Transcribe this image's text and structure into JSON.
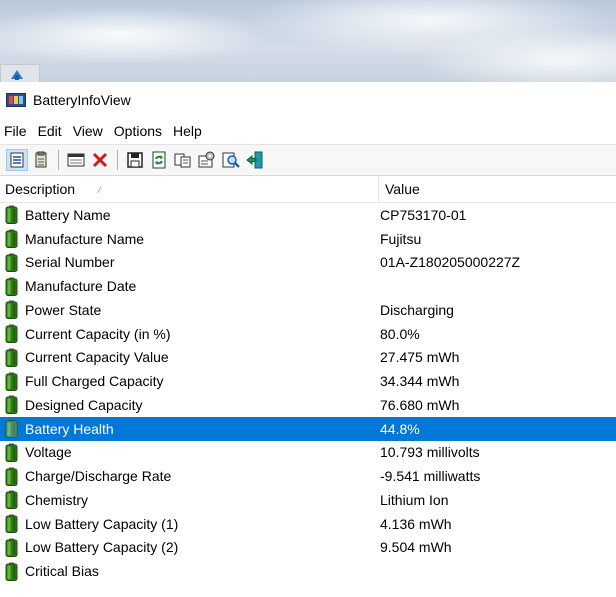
{
  "window": {
    "title": "BatteryInfoView"
  },
  "menu": [
    "File",
    "Edit",
    "View",
    "Options",
    "Help"
  ],
  "toolbar": {
    "icons": [
      "properties-icon",
      "html-report-icon",
      "window-icon",
      "delete-icon",
      "save-icon",
      "refresh-icon",
      "copy-icon",
      "options-icon",
      "find-icon",
      "exit-icon"
    ]
  },
  "columns": {
    "description": "Description",
    "value": "Value"
  },
  "colors": {
    "selection": "#0078d7",
    "battery_green": "#3a8c1f"
  },
  "rows": [
    {
      "description": "Battery Name",
      "value": "CP753170-01",
      "selected": false
    },
    {
      "description": "Manufacture Name",
      "value": "Fujitsu",
      "selected": false
    },
    {
      "description": "Serial Number",
      "value": "01A-Z180205000227Z",
      "selected": false
    },
    {
      "description": "Manufacture Date",
      "value": "",
      "selected": false
    },
    {
      "description": "Power State",
      "value": "Discharging",
      "selected": false
    },
    {
      "description": "Current Capacity (in %)",
      "value": "80.0%",
      "selected": false
    },
    {
      "description": "Current Capacity Value",
      "value": "27.475 mWh",
      "selected": false
    },
    {
      "description": "Full Charged Capacity",
      "value": "34.344 mWh",
      "selected": false
    },
    {
      "description": "Designed Capacity",
      "value": "76.680 mWh",
      "selected": false
    },
    {
      "description": "Battery Health",
      "value": "44.8%",
      "selected": true
    },
    {
      "description": "Voltage",
      "value": "10.793 millivolts",
      "selected": false
    },
    {
      "description": "Charge/Discharge Rate",
      "value": "-9.541 milliwatts",
      "selected": false
    },
    {
      "description": "Chemistry",
      "value": "Lithium Ion",
      "selected": false
    },
    {
      "description": "Low Battery Capacity (1)",
      "value": "4.136 mWh",
      "selected": false
    },
    {
      "description": "Low Battery Capacity (2)",
      "value": "9.504 mWh",
      "selected": false
    },
    {
      "description": "Critical Bias",
      "value": "",
      "selected": false
    }
  ]
}
